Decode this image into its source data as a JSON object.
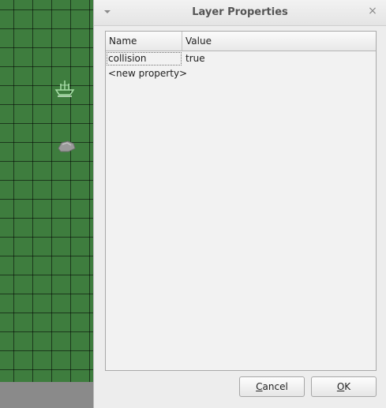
{
  "dialog": {
    "title": "Layer Properties",
    "close_glyph": "×"
  },
  "table": {
    "headers": {
      "name": "Name",
      "value": "Value"
    },
    "rows": [
      {
        "name": "collision",
        "value": "true"
      },
      {
        "name": "<new property>",
        "value": ""
      }
    ]
  },
  "buttons": {
    "cancel": {
      "mnemonic": "C",
      "rest": "ancel"
    },
    "ok": {
      "mnemonic": "O",
      "rest": "K"
    }
  },
  "colors": {
    "map_grass": "#3e7d3e",
    "dialog_bg": "#ededed"
  },
  "icons": {
    "menu": "chevron-down-icon",
    "close": "close-icon",
    "map_objects": [
      "boat-icon",
      "rock-icon"
    ]
  }
}
